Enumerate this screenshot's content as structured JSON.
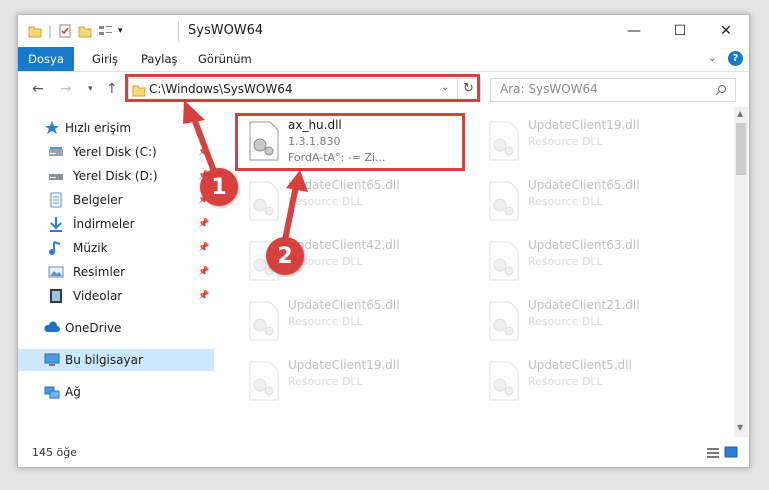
{
  "window": {
    "title": "SysWOW64",
    "controls": {
      "minimize": "—",
      "maximize": "☐",
      "close": "✕"
    }
  },
  "ribbon": {
    "tabs": [
      "Dosya",
      "Giriş",
      "Paylaş",
      "Görünüm"
    ],
    "help": "?"
  },
  "navigation": {
    "address": "C:\\Windows\\SysWOW64",
    "search_placeholder": "Ara: SysWOW64"
  },
  "sidebar": {
    "items": [
      {
        "label": "Hızlı erişim",
        "icon": "star-icon",
        "pinned": false,
        "selected": false
      },
      {
        "label": "Yerel Disk (C:)",
        "icon": "drive-icon",
        "pinned": true,
        "selected": false
      },
      {
        "label": "Yerel Disk (D:)",
        "icon": "drive-icon",
        "pinned": true,
        "selected": false
      },
      {
        "label": "Belgeler",
        "icon": "documents-icon",
        "pinned": true,
        "selected": false
      },
      {
        "label": "İndirmeler",
        "icon": "download-icon",
        "pinned": true,
        "selected": false
      },
      {
        "label": "Müzik",
        "icon": "music-icon",
        "pinned": true,
        "selected": false
      },
      {
        "label": "Resimler",
        "icon": "pictures-icon",
        "pinned": true,
        "selected": false
      },
      {
        "label": "Videolar",
        "icon": "videos-icon",
        "pinned": true,
        "selected": false
      },
      {
        "label": "OneDrive",
        "icon": "cloud-icon",
        "pinned": false,
        "selected": false
      },
      {
        "label": "Bu bilgisayar",
        "icon": "computer-icon",
        "pinned": false,
        "selected": true
      },
      {
        "label": "Ağ",
        "icon": "network-icon",
        "pinned": false,
        "selected": false
      }
    ]
  },
  "files": {
    "highlighted": {
      "name": "ax_hu.dll",
      "version": "1.3.1.830",
      "description": "FordA-tA°: -= Zi..."
    },
    "items": [
      {
        "name": "UpdateClient19.dll",
        "type": "Resource DLL"
      },
      {
        "name": "UpdateClient65.dll",
        "type": "Resource DLL"
      },
      {
        "name": "UpdateClient65.dll",
        "type": "Resource DLL"
      },
      {
        "name": "UpdateClient42.dll",
        "type": "Resource DLL"
      },
      {
        "name": "UpdateClient63.dll",
        "type": "Resource DLL"
      },
      {
        "name": "UpdateClient65.dll",
        "type": "Resource DLL"
      },
      {
        "name": "UpdateClient21.dll",
        "type": "Resource DLL"
      },
      {
        "name": "UpdateClient19.dll",
        "type": "Resource DLL"
      },
      {
        "name": "UpdateClient5.dll",
        "type": "Resource DLL"
      }
    ]
  },
  "status": {
    "count": "145 öğe"
  },
  "annotations": {
    "marker1": "1",
    "marker2": "2",
    "color": "#d84040"
  },
  "colors": {
    "accent": "#1979ca",
    "selection": "#cce8ff",
    "annotation": "#d84040"
  }
}
